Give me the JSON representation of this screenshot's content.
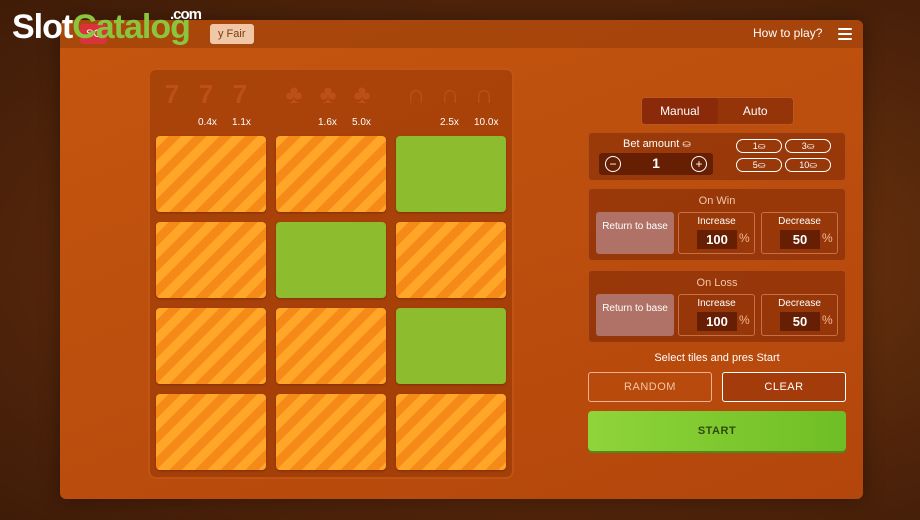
{
  "watermark": {
    "part1": "Slot",
    "part2": "Catalog",
    "domain": ".com"
  },
  "header": {
    "game_tag": "SC",
    "provably_fair": "y Fair",
    "how_to_play": "How to play?"
  },
  "board": {
    "symbol_groups": [
      {
        "icon": "seven-icon",
        "glyph": "7",
        "multipliers": [
          "0.4x",
          "1.1x"
        ]
      },
      {
        "icon": "clover-icon",
        "glyph": "♣",
        "multipliers": [
          "1.6x",
          "5.0x"
        ]
      },
      {
        "icon": "horseshoe-icon",
        "glyph": "∩",
        "multipliers": [
          "2.5x",
          "10.0x"
        ]
      }
    ],
    "tiles": [
      [
        "orange",
        "orange",
        "green"
      ],
      [
        "orange",
        "green",
        "orange"
      ],
      [
        "orange",
        "orange",
        "green"
      ],
      [
        "orange",
        "orange",
        "orange"
      ]
    ],
    "colors": {
      "orange_light": "#ffa629",
      "orange_dark": "#f58a18",
      "green": "#8dbd2e"
    }
  },
  "controls": {
    "modes": [
      "Manual",
      "Auto"
    ],
    "active_mode": "Manual",
    "bet": {
      "label": "Bet amount",
      "value": "1",
      "minus": "−",
      "plus": "+",
      "chips": [
        "1",
        "3",
        "5",
        "10"
      ]
    },
    "on_win": {
      "title": "On Win",
      "return_to_base": "Return to base",
      "increase_label": "Increase",
      "increase_value": "100",
      "decrease_label": "Decrease",
      "decrease_value": "50",
      "percent": "%"
    },
    "on_loss": {
      "title": "On Loss",
      "return_to_base": "Return to base",
      "increase_label": "Increase",
      "increase_value": "100",
      "decrease_label": "Decrease",
      "decrease_value": "50",
      "percent": "%"
    },
    "hint": "Select tiles and pres Start",
    "random": "RANDOM",
    "clear": "CLEAR",
    "start": "START"
  }
}
